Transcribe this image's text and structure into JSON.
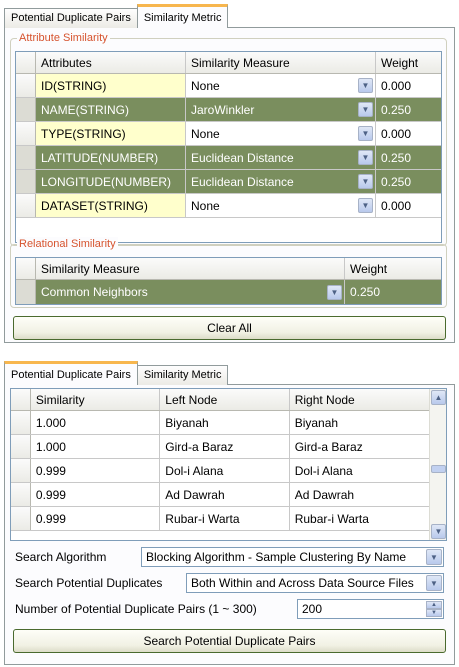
{
  "top_panel": {
    "tabs": [
      {
        "label": "Potential Duplicate Pairs",
        "active": false
      },
      {
        "label": "Similarity Metric",
        "active": true
      }
    ],
    "attribute_group": {
      "title": "Attribute Similarity",
      "columns": [
        "Attributes",
        "Similarity Measure",
        "Weight"
      ],
      "rows": [
        {
          "attribute": "ID(STRING)",
          "measure": "None",
          "weight": "0.000",
          "selected": false
        },
        {
          "attribute": "NAME(STRING)",
          "measure": "JaroWinkler",
          "weight": "0.250",
          "selected": true
        },
        {
          "attribute": "TYPE(STRING)",
          "measure": "None",
          "weight": "0.000",
          "selected": false
        },
        {
          "attribute": "LATITUDE(NUMBER)",
          "measure": "Euclidean Distance",
          "weight": "0.250",
          "selected": true
        },
        {
          "attribute": "LONGITUDE(NUMBER)",
          "measure": "Euclidean Distance",
          "weight": "0.250",
          "selected": true
        },
        {
          "attribute": "DATASET(STRING)",
          "measure": "None",
          "weight": "0.000",
          "selected": false
        }
      ]
    },
    "relational_group": {
      "title": "Relational Similarity",
      "columns": [
        "Similarity Measure",
        "Weight"
      ],
      "rows": [
        {
          "measure": "Common Neighbors",
          "weight": "0.250",
          "selected": true
        }
      ]
    },
    "clear_all_label": "Clear All"
  },
  "bottom_panel": {
    "tabs": [
      {
        "label": "Potential Duplicate Pairs",
        "active": true
      },
      {
        "label": "Similarity Metric",
        "active": false
      }
    ],
    "list": {
      "columns": [
        "Similarity",
        "Left Node",
        "Right Node"
      ],
      "rows": [
        {
          "similarity": "1.000",
          "left": "Biyanah",
          "right": "Biyanah"
        },
        {
          "similarity": "1.000",
          "left": "Gird-a Baraz",
          "right": "Gird-a Baraz"
        },
        {
          "similarity": "0.999",
          "left": "Dol-i Alana",
          "right": "Dol-i Alana"
        },
        {
          "similarity": "0.999",
          "left": "Ad Dawrah",
          "right": "Ad Dawrah"
        },
        {
          "similarity": "0.999",
          "left": "Rubar-i Warta",
          "right": "Rubar-i Warta"
        }
      ]
    },
    "search_algorithm": {
      "label": "Search Algorithm",
      "value": "Blocking Algorithm - Sample Clustering By Name"
    },
    "search_duplicates": {
      "label": "Search Potential Duplicates",
      "value": "Both Within and Across Data Source Files"
    },
    "num_pairs": {
      "label": "Number of Potential Duplicate Pairs  (1 ~ 300)",
      "value": "200"
    },
    "search_button_label": "Search Potential Duplicate Pairs"
  },
  "colors": {
    "selected_row": "#7a8e5e",
    "attribute_cell": "#ffffcc",
    "group_title": "#d6532e",
    "active_tab_accent": "#f7b64e"
  },
  "icons": {
    "combo": "chevron-down-icon",
    "scroll_up": "chevron-up-icon",
    "scroll_down": "chevron-down-icon",
    "spin": "spin-updown-icon"
  }
}
